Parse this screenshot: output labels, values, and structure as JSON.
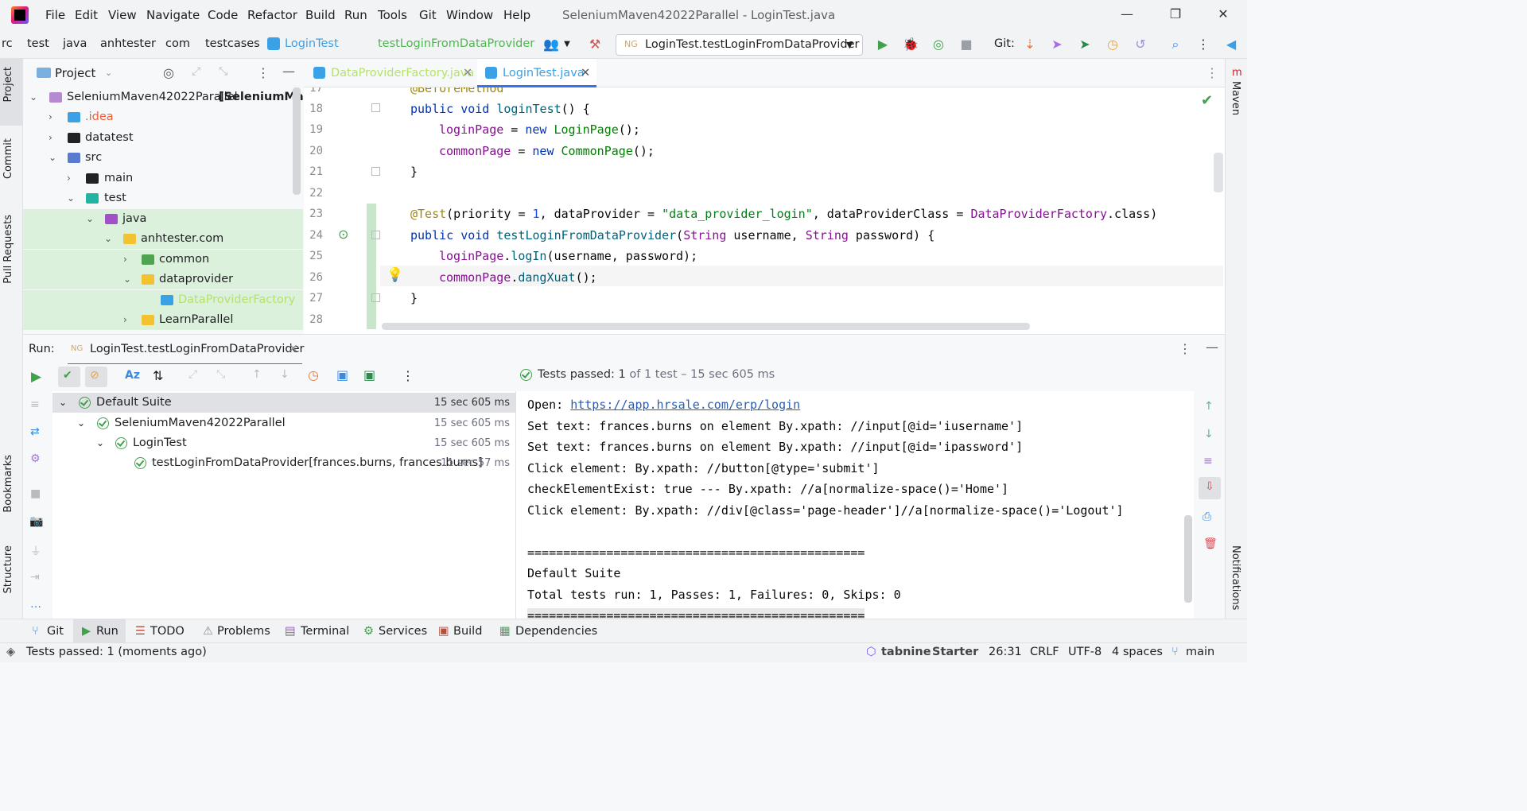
{
  "window": {
    "title": "SeleniumMaven42022Parallel - LoginTest.java"
  },
  "menu": [
    "File",
    "Edit",
    "View",
    "Navigate",
    "Code",
    "Refactor",
    "Build",
    "Run",
    "Tools",
    "Git",
    "Window",
    "Help"
  ],
  "breadcrumbs": [
    "rc",
    "test",
    "java",
    "anhtester",
    "com",
    "testcases",
    "LoginTest",
    "testLoginFromDataProvider"
  ],
  "run_config": {
    "label": "LoginTest.testLoginFromDataProvider"
  },
  "git_label": "Git:",
  "left_stripe": {
    "project": "Project",
    "commit": "Commit",
    "pull_requests": "Pull Requests",
    "bookmarks": "Bookmarks",
    "structure": "Structure"
  },
  "right_stripe": {
    "maven": "Maven",
    "notifications": "Notifications"
  },
  "project_panel": {
    "title": "Project",
    "tree": [
      {
        "label": "SeleniumMaven42022Parallel",
        "suffix": "[SeleniumMave",
        "color": "#1e1f22"
      },
      {
        "label": ".idea",
        "color": "#e8603c"
      },
      {
        "label": "datatest",
        "color": "#1e1f22"
      },
      {
        "label": "src",
        "color": "#1e1f22"
      },
      {
        "label": "main",
        "color": "#1e1f22"
      },
      {
        "label": "test",
        "color": "#1e1f22"
      },
      {
        "label": "java",
        "color": "#1e1f22"
      },
      {
        "label": "anhtester.com",
        "color": "#1e1f22"
      },
      {
        "label": "common",
        "color": "#1e1f22"
      },
      {
        "label": "dataprovider",
        "color": "#1e1f22"
      },
      {
        "label": "DataProviderFactory",
        "color": "#b6e16f"
      },
      {
        "label": "LearnParallel",
        "color": "#1e1f22"
      }
    ]
  },
  "editor": {
    "tabs": [
      {
        "label": "DataProviderFactory.java",
        "active": false
      },
      {
        "label": "LoginTest.java",
        "active": true
      }
    ],
    "line_numbers": [
      "17",
      "18",
      "19",
      "20",
      "21",
      "22",
      "23",
      "24",
      "25",
      "26",
      "27",
      "28"
    ],
    "lines": {
      "l17": "@BeforeMethod",
      "l18_kw": "public void ",
      "l18_fn": "loginTest",
      "l18_rest": "() {",
      "l19_var": "loginPage",
      "l19_eq": " = ",
      "l19_new": "new ",
      "l19_cls": "LoginPage",
      "l19_end": "();",
      "l20_var": "commonPage",
      "l20_eq": " = ",
      "l20_new": "new ",
      "l20_cls": "CommonPage",
      "l20_end": "();",
      "l21": "}",
      "l23_an": "@Test",
      "l23_a": "(priority = ",
      "l23_num": "1",
      "l23_b": ", dataProvider = ",
      "l23_str": "\"data_provider_login\"",
      "l23_c": ", dataProviderClass = ",
      "l23_cls": "DataProviderFactory",
      "l23_d": ".class)",
      "l24_kw": "public void ",
      "l24_fn": "testLoginFromDataProvider",
      "l24_a": "(",
      "l24_t1": "String",
      "l24_b": " username, ",
      "l24_t2": "String",
      "l24_c": " password) {",
      "l25_var": "loginPage",
      "l25_dot": ".",
      "l25_m": "logIn",
      "l25_rest": "(username, password);",
      "l26_var": "commonPage",
      "l26_dot": ".",
      "l26_m": "dangXuat",
      "l26_rest": "();",
      "l27": "}"
    }
  },
  "run": {
    "label": "Run:",
    "tab": "LoginTest.testLoginFromDataProvider",
    "summary_prefix": "Tests passed:",
    "summary_count": "1",
    "summary_rest": "of 1 test – 15 sec 605 ms",
    "tree": [
      {
        "label": "Default Suite",
        "time": "15 sec 605 ms"
      },
      {
        "label": "SeleniumMaven42022Parallel",
        "time": "15 sec 605 ms"
      },
      {
        "label": "LoginTest",
        "time": "15 sec 605 ms"
      },
      {
        "label": "testLoginFromDataProvider[frances.burns, frances.burns]",
        "time": "11 sec 57 ms"
      }
    ],
    "console": {
      "open_prefix": "Open: ",
      "open_url": "https://app.hrsale.com/erp/login",
      "lines": [
        "Set text: frances.burns on element By.xpath: //input[@id='iusername']",
        "Set text: frances.burns on element By.xpath: //input[@id='ipassword']",
        "Click element: By.xpath: //button[@type='submit']",
        "checkElementExist: true --- By.xpath: //a[normalize-space()='Home']",
        "Click element: By.xpath: //div[@class='page-header']//a[normalize-space()='Logout']",
        "",
        "===============================================",
        "Default Suite",
        "Total tests run: 1, Passes: 1, Failures: 0, Skips: 0",
        "==============================================="
      ]
    }
  },
  "bottom_tools": [
    "Git",
    "Run",
    "TODO",
    "Problems",
    "Terminal",
    "Services",
    "Build",
    "Dependencies"
  ],
  "status": {
    "message": "Tests passed: 1 (moments ago)",
    "tabnine": "tabnine",
    "tabnine_plan": "Starter",
    "position": "26:31",
    "line_sep": "CRLF",
    "encoding": "UTF-8",
    "indent": "4 spaces",
    "branch": "main"
  }
}
